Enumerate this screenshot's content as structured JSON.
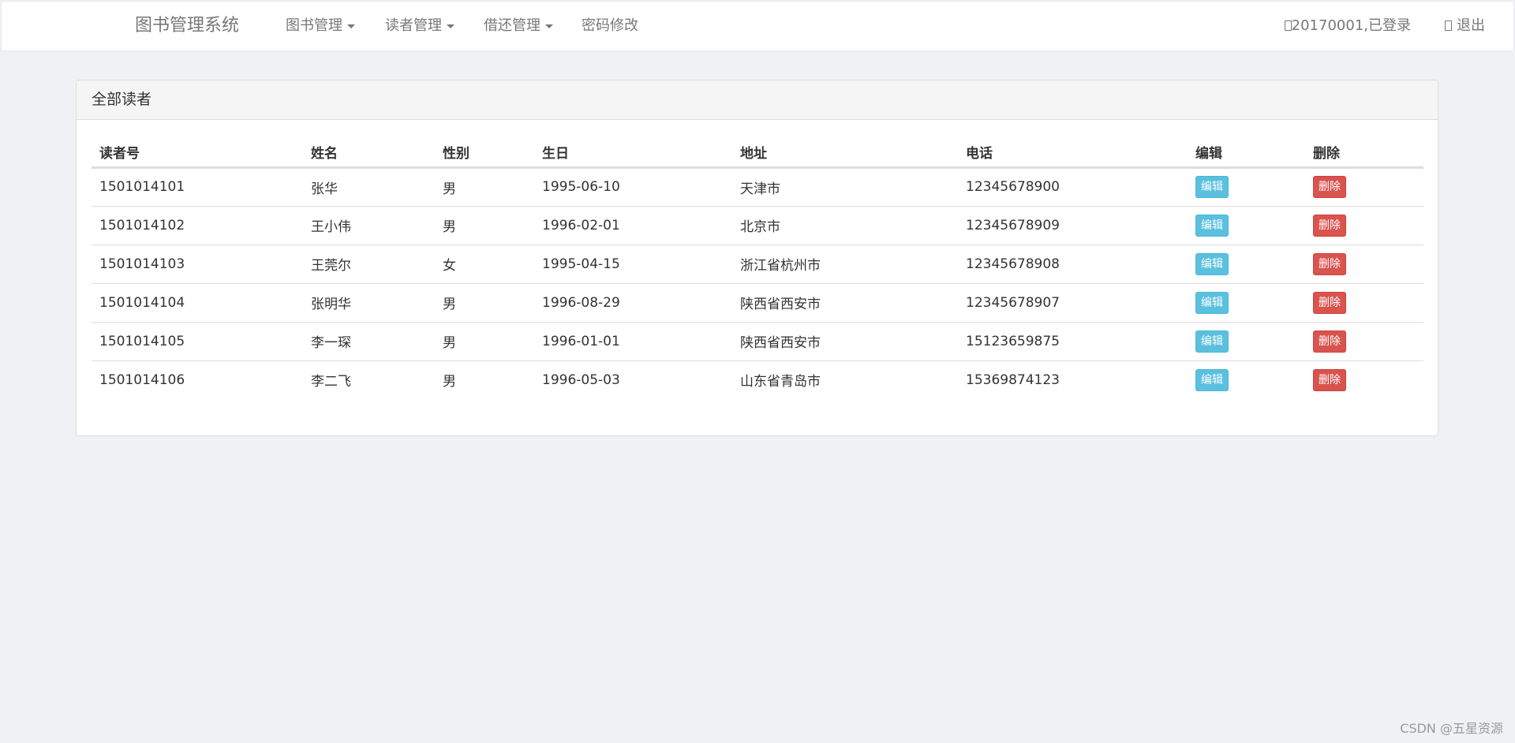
{
  "navbar": {
    "brand": "图书管理系统",
    "menus": [
      {
        "label": "图书管理",
        "dropdown": true
      },
      {
        "label": "读者管理",
        "dropdown": true
      },
      {
        "label": "借还管理",
        "dropdown": true
      },
      {
        "label": "密码修改",
        "dropdown": false
      }
    ],
    "user_status": "20170001,已登录",
    "logout_label": "退出"
  },
  "panel": {
    "title": "全部读者",
    "columns": [
      "读者号",
      "姓名",
      "性别",
      "生日",
      "地址",
      "电话",
      "编辑",
      "删除"
    ],
    "edit_label": "编辑",
    "delete_label": "删除",
    "rows": [
      {
        "id": "1501014101",
        "name": "张华",
        "gender": "男",
        "birthday": "1995-06-10",
        "address": "天津市",
        "phone": "12345678900"
      },
      {
        "id": "1501014102",
        "name": "王小伟",
        "gender": "男",
        "birthday": "1996-02-01",
        "address": "北京市",
        "phone": "12345678909"
      },
      {
        "id": "1501014103",
        "name": "王莞尔",
        "gender": "女",
        "birthday": "1995-04-15",
        "address": "浙江省杭州市",
        "phone": "12345678908"
      },
      {
        "id": "1501014104",
        "name": "张明华",
        "gender": "男",
        "birthday": "1996-08-29",
        "address": "陕西省西安市",
        "phone": "12345678907"
      },
      {
        "id": "1501014105",
        "name": "李一琛",
        "gender": "男",
        "birthday": "1996-01-01",
        "address": "陕西省西安市",
        "phone": "15123659875"
      },
      {
        "id": "1501014106",
        "name": "李二飞",
        "gender": "男",
        "birthday": "1996-05-03",
        "address": "山东省青岛市",
        "phone": "15369874123"
      }
    ]
  },
  "watermark": "CSDN @五星资源",
  "colors": {
    "page_bg": "#eff1f5",
    "edit_button": "#5bc0de",
    "delete_button": "#d9534f"
  }
}
